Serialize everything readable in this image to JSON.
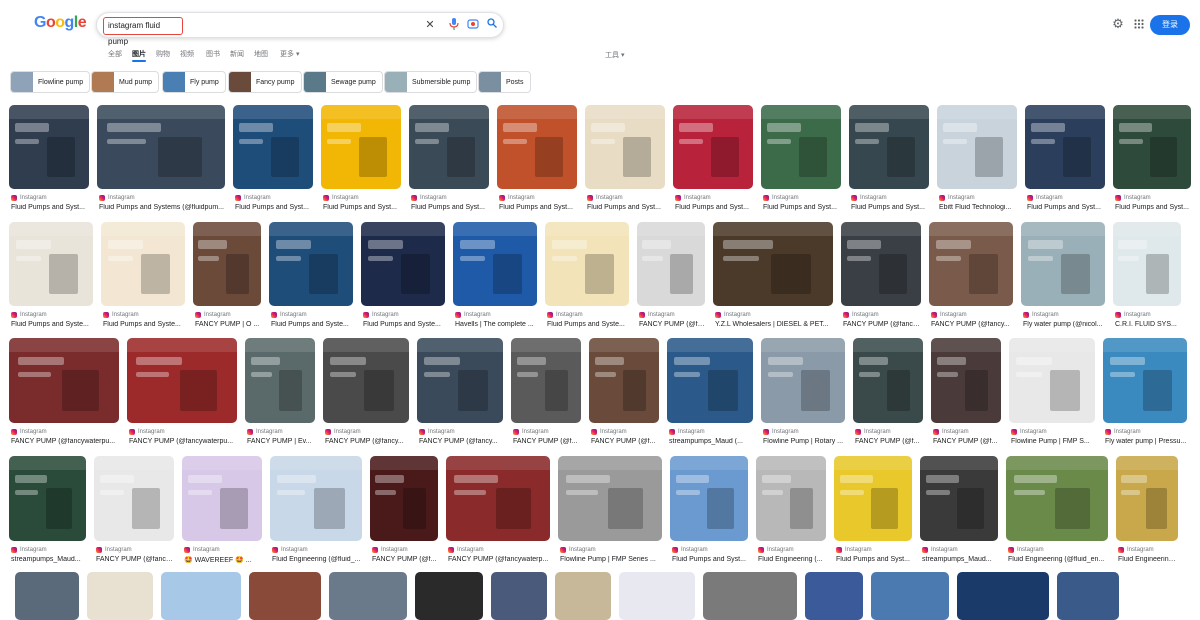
{
  "header": {
    "logo": [
      "G",
      "o",
      "o",
      "g",
      "l",
      "e"
    ],
    "logo_colors": [
      "#4285F4",
      "#EA4335",
      "#FBBC05",
      "#4285F4",
      "#34A853",
      "#EA4335"
    ],
    "search_value": "instagram fluid pump",
    "sign_in": "登录",
    "accent": "#1a73e8"
  },
  "tabs": [
    "全部",
    "图片",
    "购物",
    "视频",
    "图书",
    "新闻",
    "地图",
    "更多"
  ],
  "tools": "工具",
  "chips": [
    "Flowline pump",
    "Mud pump",
    "Fly pump",
    "Fancy pump",
    "Sewage pump",
    "Submersible pump",
    "Posts"
  ],
  "results": {
    "source": "Instagram",
    "rows": [
      [
        "Fluid Pumps and Syst...",
        "Fluid Pumps and Systems (@fluidpum...",
        "Fluid Pumps and Syst...",
        "Fluid Pumps and Syst...",
        "Fluid Pumps and Syst...",
        "Fluid Pumps and Syst...",
        "Fluid Pumps and Syst...",
        "Fluid Pumps and Syst...",
        "Fluid Pumps and Syst...",
        "Fluid Pumps and Syst...",
        "Ebitt Fluid Technologi...",
        "Fluid Pumps and Syst...",
        "Fluid Pumps and Syst..."
      ],
      [
        "Fluid Pumps and Syste...",
        "Fluid Pumps and Syste...",
        "FANCY PUMP | O ...",
        "Fluid Pumps and Syste...",
        "Fluid Pumps and Syste...",
        "Havells | The complete ...",
        "Fluid Pumps and Syste...",
        "FANCY PUMP (@fa...",
        "Y.Z.L Wholesalers | DIESEL & PET...",
        "FANCY PUMP (@fancy...",
        "FANCY PUMP (@fancy...",
        "Fly water pump (@nicol...",
        "C.R.I. FLUID SYS..."
      ],
      [
        "FANCY PUMP (@fancywaterpu...",
        "FANCY PUMP (@fancywaterpu...",
        "FANCY PUMP | Ev...",
        "FANCY PUMP (@fancy...",
        "FANCY PUMP (@fancy...",
        "FANCY PUMP (@f...",
        "FANCY PUMP (@f...",
        "streampumps_Maud (...",
        "Flowline Pump | Rotary ...",
        "FANCY PUMP (@f...",
        "FANCY PUMP (@f...",
        "Flowline Pump | FMP S...",
        "Fly water pump | Pressu..."
      ],
      [
        "streampumps_Maud...",
        "FANCY PUMP (@fancy...",
        "🤩 WAVEREEF 🤩 ...",
        "Fluid Engineering (@fluid_...",
        "FANCY PUMP (@f...",
        "FANCY PUMP (@fancywaterp...",
        "Flowline Pump | FMP Series ...",
        "Fluid Pumps and Syst...",
        "Fluid Engineering (...",
        "Fluid Pumps and Syst...",
        "streampumps_Maud...",
        "Fluid Engineering (@fluid_en...",
        "Fluid Engineering (..."
      ]
    ]
  }
}
